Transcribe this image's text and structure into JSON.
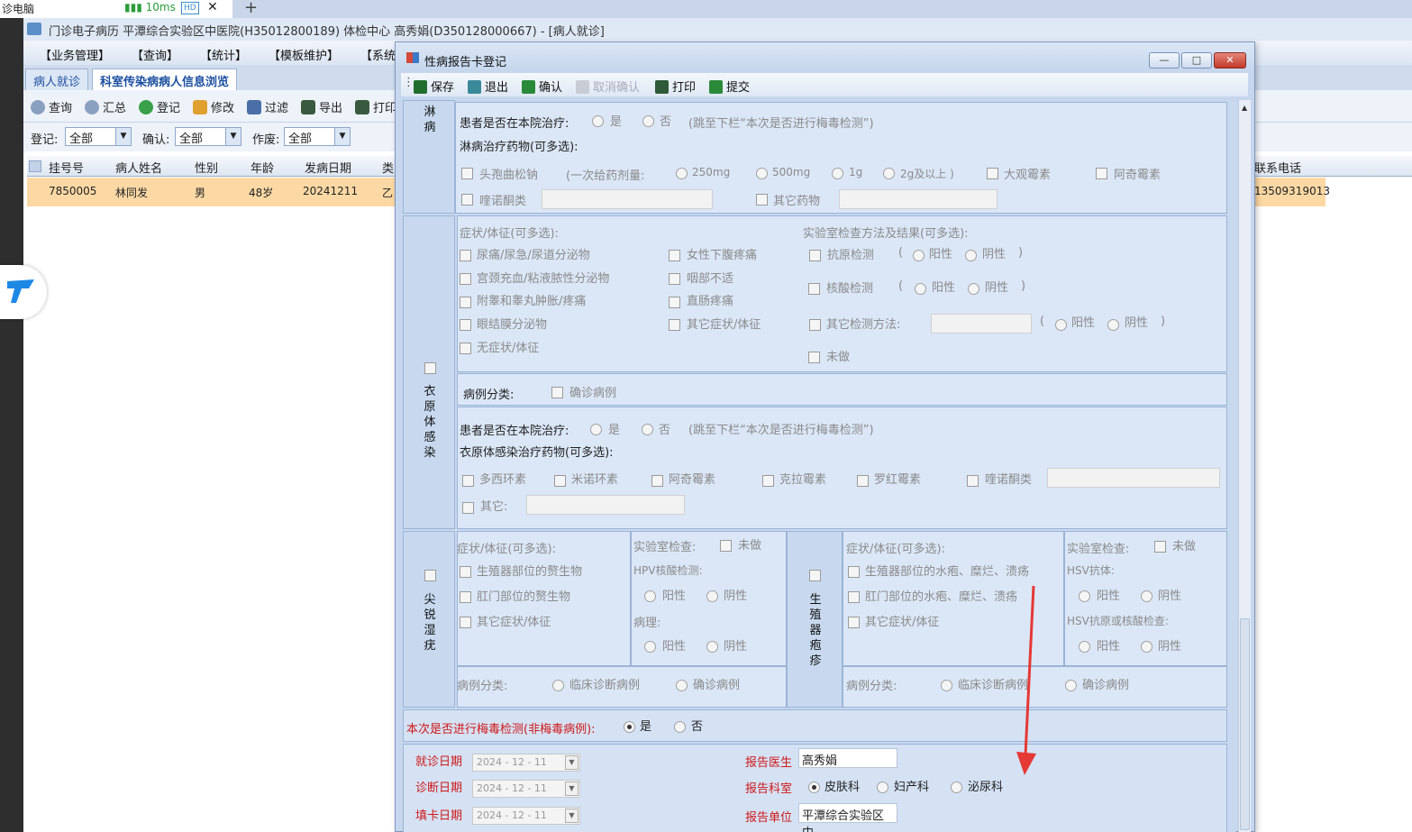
{
  "remote": {
    "tab_title": "诊电脑",
    "latency": "10ms",
    "hd": "HD",
    "close": "✕",
    "new_tab": "+"
  },
  "app": {
    "title": "门诊电子病历  平潭综合实验区中医院(H35012800189)  体检中心  高秀娟(D350128000667) - [病人就诊]",
    "menu": [
      "【业务管理】",
      "【查询】",
      "【统计】",
      "【模板维护】",
      "【系统"
    ],
    "tabs": [
      "病人就诊",
      "科室传染病病人信息浏览"
    ],
    "toolbar": [
      "查询",
      "汇总",
      "登记",
      "修改",
      "过滤",
      "导出",
      "打印"
    ],
    "filters": {
      "register_label": "登记:",
      "register_value": "全部",
      "confirm_label": "确认:",
      "confirm_value": "全部",
      "void_label": "作废:",
      "void_value": "全部"
    },
    "grid": {
      "columns": [
        "挂号号",
        "病人姓名",
        "性别",
        "年龄",
        "发病日期",
        "类",
        "联系电话"
      ],
      "rows": [
        {
          "reg_no": "7850005",
          "name": "林同发",
          "sex": "男",
          "age": "48岁",
          "onset": "20241211",
          "type": "乙",
          "phone": "13509319013"
        }
      ]
    }
  },
  "dialog": {
    "title": "性病报告卡登记",
    "window_buttons": {
      "min": "—",
      "max": "□",
      "close": "✕"
    },
    "toolbar": {
      "save": "保存",
      "exit": "退出",
      "confirm": "确认",
      "cancel_confirm": "取消确认",
      "print": "打印",
      "submit": "提交"
    },
    "gonorrhea": {
      "section_label": "淋病",
      "treat_in_hospital": "患者是否在本院治疗:",
      "yes": "是",
      "no": "否",
      "skip_note": "(跳至下栏“本次是否进行梅毒检测”)",
      "drugs_label": "淋病治疗药物(可多选):",
      "ceftriaxone": "头孢曲松钠",
      "dose_label": "(一次给药剂量:",
      "doses": [
        "250mg",
        "500mg",
        "1g",
        "2g及以上  )"
      ],
      "spectinomycin": "大观霉素",
      "azithromycin": "阿奇霉素",
      "quinolone": "喹诺酮类",
      "other_drug": "其它药物"
    },
    "chlamydia": {
      "section_label": "衣原体感染",
      "symptoms_label": "症状/体征(可多选):",
      "symptoms_left": [
        "尿痛/尿急/尿道分泌物",
        "宫颈充血/粘液脓性分泌物",
        "附睾和睾丸肿胀/疼痛",
        "眼结膜分泌物",
        "无症状/体征"
      ],
      "symptoms_right": [
        "女性下腹疼痛",
        "咽部不适",
        "直肠疼痛",
        "其它症状/体征"
      ],
      "lab_label": "实验室检查方法及结果(可多选):",
      "antigen": "抗原检测",
      "nucleic": "核酸检测",
      "other_method": "其它检测方法:",
      "positive": "阳性",
      "negative": "阴性",
      "open_paren": "(",
      "close_paren": ")",
      "not_done": "未做",
      "case_class_label": "病例分类:",
      "confirmed": "确诊病例",
      "treat_in_hospital": "患者是否在本院治疗:",
      "yes": "是",
      "no": "否",
      "skip_note": "(跳至下栏“本次是否进行梅毒检测”)",
      "drugs_label": "衣原体感染治疗药物(可多选):",
      "drugs": [
        "多西环素",
        "米诺环素",
        "阿奇霉素",
        "克拉霉素",
        "罗红霉素",
        "喹诺酮类"
      ],
      "other": "其它:"
    },
    "condyloma": {
      "section_label": "尖锐湿疣",
      "symptoms_label": "症状/体征(可多选):",
      "symptoms": [
        "生殖器部位的赘生物",
        "肛门部位的赘生物",
        "其它症状/体征"
      ],
      "lab_label": "实验室检查:",
      "not_done": "未做",
      "hpv_label": "HPV核酸检测:",
      "pathology_label": "病理:",
      "positive": "阳性",
      "negative": "阴性",
      "case_class_label": "病例分类:",
      "clinical": "临床诊断病例",
      "confirmed": "确诊病例"
    },
    "herpes": {
      "section_label": "生殖器疱疹",
      "symptoms_label": "症状/体征(可多选):",
      "symptoms": [
        "生殖器部位的水疱、糜烂、溃疡",
        "肛门部位的水疱、糜烂、溃疡",
        "其它症状/体征"
      ],
      "lab_label": "实验室检查:",
      "not_done": "未做",
      "hsv_ab_label": "HSV抗体:",
      "hsv_ag_label": "HSV抗原或核酸检查:",
      "positive": "阳性",
      "negative": "阴性",
      "case_class_label": "病例分类:",
      "clinical": "临床诊断病例",
      "confirmed": "确诊病例"
    },
    "syphilis_test": {
      "label": "本次是否进行梅毒检测(非梅毒病例):",
      "yes": "是",
      "no": "否",
      "selected": "是"
    },
    "dates": {
      "visit_label": "就诊日期",
      "visit_value": "2024 - 12 - 11",
      "diagnosis_label": "诊断日期",
      "diagnosis_value": "2024 - 12 - 11",
      "fill_label": "填卡日期",
      "fill_value": "2024 - 12 - 11"
    },
    "report": {
      "doctor_label": "报告医生",
      "doctor_value": "高秀娟",
      "dept_label": "报告科室",
      "depts": [
        "皮肤科",
        "妇产科",
        "泌尿科"
      ],
      "dept_selected": "皮肤科",
      "unit_label": "报告单位",
      "unit_value": "平潭综合实验区中"
    }
  },
  "colors": {
    "accent_red": "#d01818",
    "annotation_arrow": "#e53935",
    "selected_row": "#fcd9a4",
    "dialog_bg": "#c6d6ed"
  }
}
